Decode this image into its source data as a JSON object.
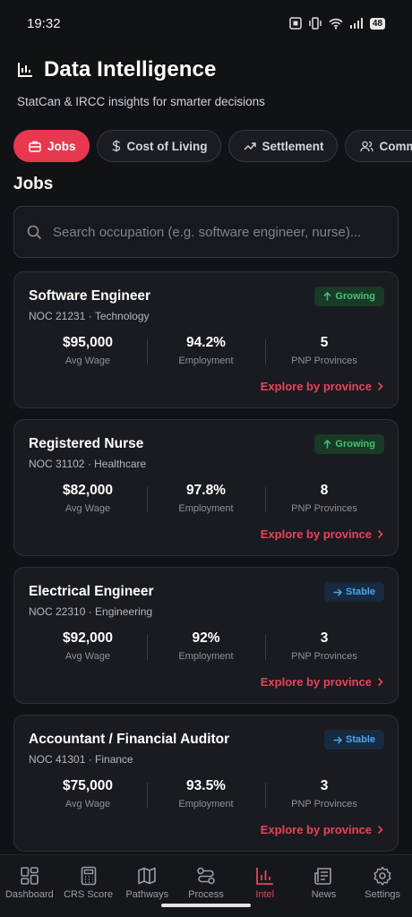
{
  "status_bar": {
    "time": "19:32",
    "battery": "48"
  },
  "header": {
    "title": "Data Intelligence",
    "subtitle": "StatCan & IRCC insights for smarter decisions"
  },
  "tabs": [
    {
      "label": "Jobs",
      "icon": "briefcase-icon",
      "active": true
    },
    {
      "label": "Cost of Living",
      "icon": "dollar-icon",
      "active": false
    },
    {
      "label": "Settlement",
      "icon": "trending-up-icon",
      "active": false
    },
    {
      "label": "Community",
      "icon": "users-icon",
      "active": false
    }
  ],
  "section_title": "Jobs",
  "search": {
    "placeholder": "Search occupation (e.g. software engineer, nurse)...",
    "value": ""
  },
  "cards": [
    {
      "title": "Software Engineer",
      "subtitle": "NOC 21231 · Technology",
      "badge": "Growing",
      "badge_type": "growing",
      "stats": [
        {
          "value": "$95,000",
          "label": "Avg Wage"
        },
        {
          "value": "94.2%",
          "label": "Employment"
        },
        {
          "value": "5",
          "label": "PNP Provinces"
        }
      ],
      "link": "Explore by province"
    },
    {
      "title": "Registered Nurse",
      "subtitle": "NOC 31102 · Healthcare",
      "badge": "Growing",
      "badge_type": "growing",
      "stats": [
        {
          "value": "$82,000",
          "label": "Avg Wage"
        },
        {
          "value": "97.8%",
          "label": "Employment"
        },
        {
          "value": "8",
          "label": "PNP Provinces"
        }
      ],
      "link": "Explore by province"
    },
    {
      "title": "Electrical Engineer",
      "subtitle": "NOC 22310 · Engineering",
      "badge": "Stable",
      "badge_type": "stable",
      "stats": [
        {
          "value": "$92,000",
          "label": "Avg Wage"
        },
        {
          "value": "92%",
          "label": "Employment"
        },
        {
          "value": "3",
          "label": "PNP Provinces"
        }
      ],
      "link": "Explore by province"
    },
    {
      "title": "Accountant / Financial Auditor",
      "subtitle": "NOC 41301 · Finance",
      "badge": "Stable",
      "badge_type": "stable",
      "stats": [
        {
          "value": "$75,000",
          "label": "Avg Wage"
        },
        {
          "value": "93.5%",
          "label": "Employment"
        },
        {
          "value": "3",
          "label": "PNP Provinces"
        }
      ],
      "link": "Explore by province"
    }
  ],
  "bottom_nav": [
    {
      "label": "Dashboard",
      "icon": "dashboard-icon",
      "active": false
    },
    {
      "label": "CRS Score",
      "icon": "calculator-icon",
      "active": false
    },
    {
      "label": "Pathways",
      "icon": "map-icon",
      "active": false
    },
    {
      "label": "Process",
      "icon": "process-icon",
      "active": false
    },
    {
      "label": "Intel",
      "icon": "bar-chart-icon",
      "active": true
    },
    {
      "label": "News",
      "icon": "newspaper-icon",
      "active": false
    },
    {
      "label": "Settings",
      "icon": "gear-icon",
      "active": false
    }
  ],
  "colors": {
    "accent": "#e8384f",
    "background": "#111216",
    "card": "#1a1b20",
    "growing": "#45c46e",
    "stable": "#4ea5ea"
  }
}
